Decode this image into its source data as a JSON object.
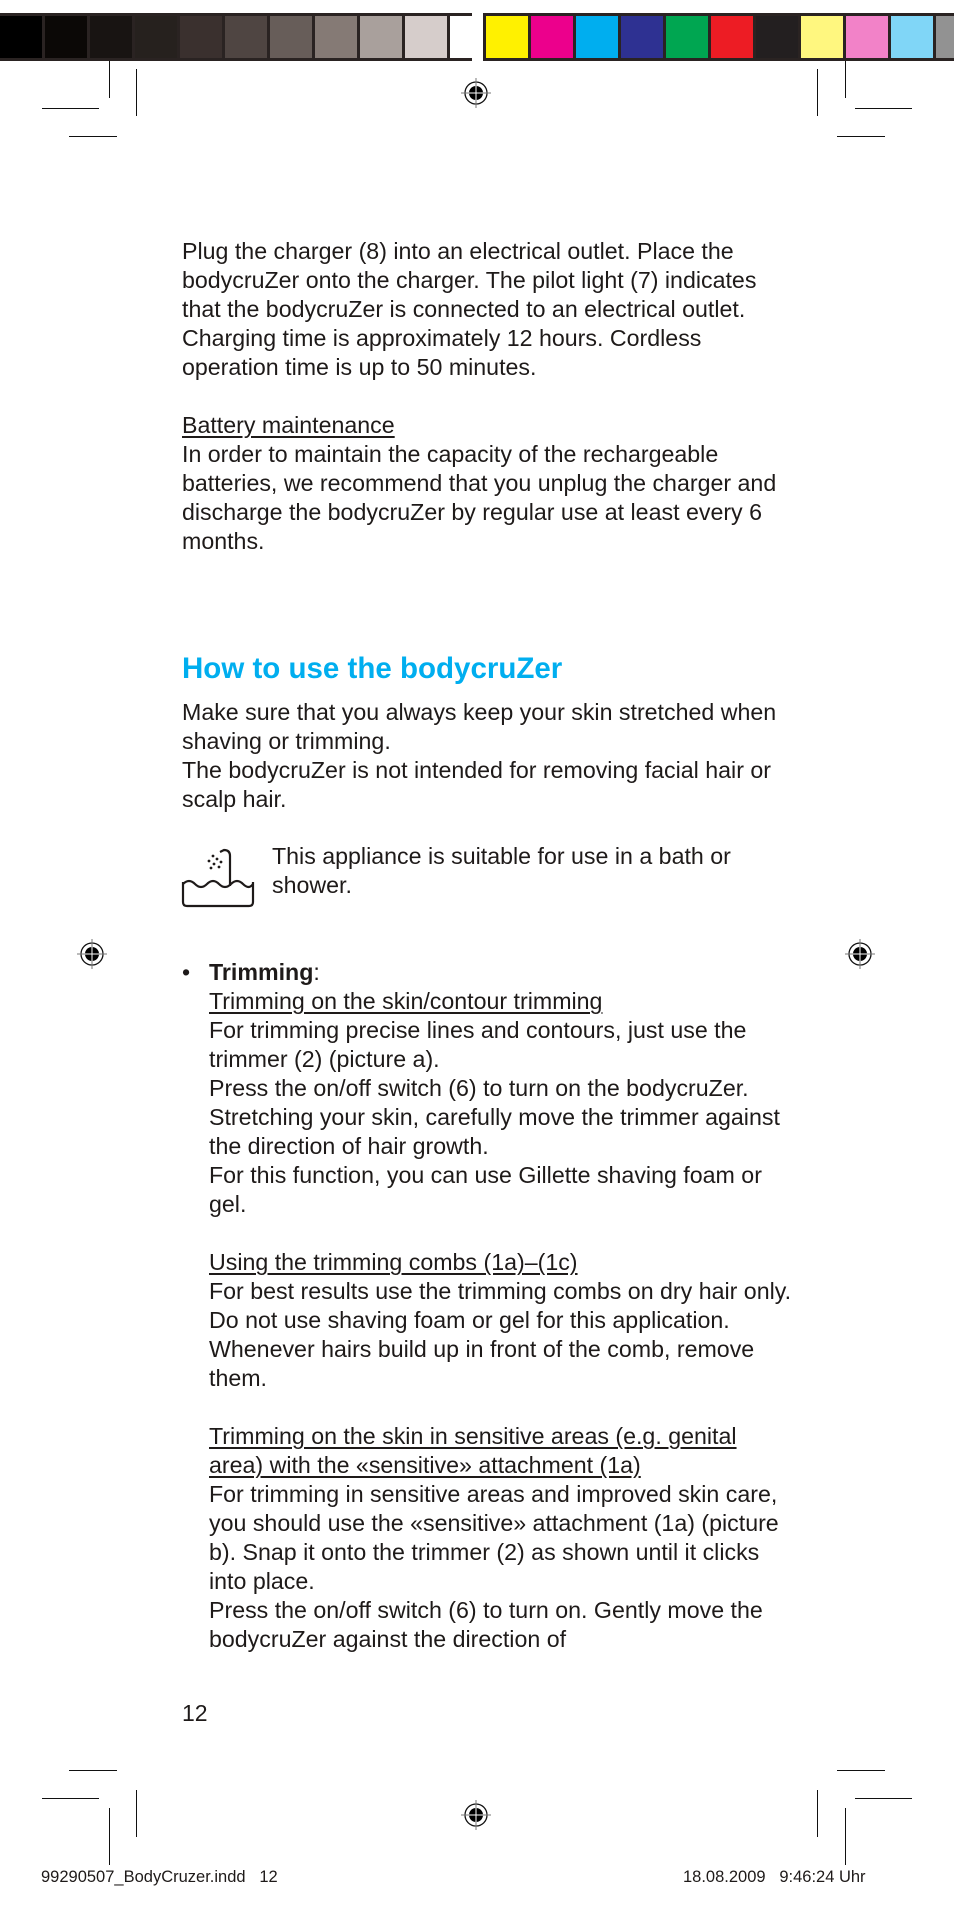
{
  "color_bar": {
    "left_swatches": [
      "#000000",
      "#0b0806",
      "#181412",
      "#26211e",
      "#3a302e",
      "#4f4542",
      "#675d59",
      "#857a75",
      "#a9a09c",
      "#d6cdcb",
      "#ffffff"
    ],
    "right_swatches": [
      "#fff100",
      "#ec008c",
      "#00aeef",
      "#2e3192",
      "#00a651",
      "#ed1c24",
      "#231f20",
      "#fff77f",
      "#f282c8",
      "#80d6f7",
      "#929292"
    ]
  },
  "body": {
    "para1": "Plug the charger (8) into an electrical outlet. Place the bodycruZer onto the charger. The pilot light (7) indicates that the bodycruZer is connected to an electrical outlet.",
    "para2": "Charging time is approximately 12 hours. Cordless operation time is up to 50 minutes.",
    "battery_heading": "Battery maintenance",
    "battery_text": "In order to maintain the capacity of the recharge­able batteries, we recommend that you unplug the charger and discharge the bodycruZer by regular use at least every 6 months."
  },
  "section": {
    "heading": "How to use the bodycruZer",
    "heading_color": "#00aeef",
    "para1": "Make sure that you always keep your skin stretched when shaving or trimming.",
    "para2": "The bodycruZer is not intended for removing facial hair or scalp hair.",
    "bath_icon": "bath-shower-icon",
    "bath_text": "This appliance is suitable for use in a bath or shower."
  },
  "trimming": {
    "bullet": "•",
    "title": "Trimming",
    "colon": ":",
    "sub1_heading": "Trimming on the skin/contour trimming",
    "sub1_lines": [
      "For trimming precise lines and contours, just use the trimmer (2) (picture a).",
      "Press the on/off switch (6) to turn on the bodycruZer.",
      "Stretching your skin, carefully move the trimmer against the direction of hair growth.",
      "For this function, you can use Gillette shaving foam or gel."
    ],
    "sub2_heading": "Using the trimming combs (1a)–(1c)",
    "sub2_text": "For best results use the trimming combs on dry hair only. Do not use shaving foam or gel for this application. Whenever hairs build up in front of the comb, remove them.",
    "sub3_heading": "Trimming on the skin in sensitive areas (e.g. genital area) with the «sensitive» attachment (1a)",
    "sub3_lines": [
      "For trimming in sensitive areas and improved skin care, you should use the «sensitive» attachment (1a) (picture b). Snap it onto the trimmer (2) as shown until it clicks into place.",
      "Press the on/off switch (6) to turn on. Gently move the bodycruZer against the direction of"
    ]
  },
  "footer": {
    "page_number": "12",
    "slug_file": "99290507_BodyCruzer.indd   12",
    "slug_date": "18.08.2009   9:46:24 Uhr"
  }
}
